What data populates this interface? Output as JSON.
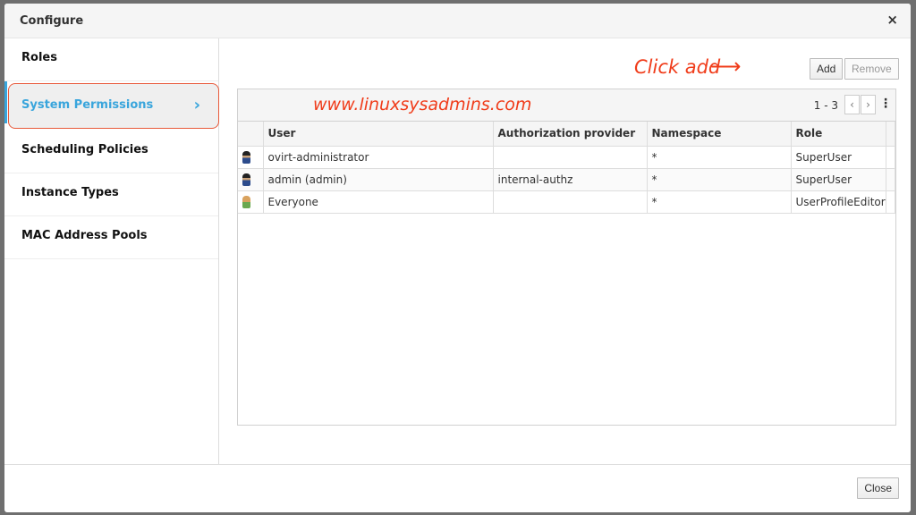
{
  "dialog": {
    "title": "Configure",
    "close_x": "×",
    "close_label": "Close"
  },
  "sidebar": {
    "items": [
      {
        "label": "Roles"
      },
      {
        "label": "System Permissions",
        "active": true
      },
      {
        "label": "Scheduling Policies"
      },
      {
        "label": "Instance Types"
      },
      {
        "label": "MAC Address Pools"
      }
    ],
    "chevron": "›"
  },
  "toolbar": {
    "add_label": "Add",
    "remove_label": "Remove"
  },
  "annotations": {
    "click_add": "Click add",
    "arrow": "⟶",
    "watermark": "www.linuxsysadmins.com",
    "color": "#f03c1a"
  },
  "pagination": {
    "range": "1 - 3",
    "prev": "‹",
    "next": "›",
    "kebab": "⋮"
  },
  "table": {
    "columns": [
      "User",
      "Authorization provider",
      "Namespace",
      "Role"
    ],
    "rows": [
      {
        "icon": "admin-user-icon",
        "user": "ovirt-administrator",
        "provider": "",
        "namespace": "*",
        "role": "SuperUser"
      },
      {
        "icon": "admin-user-icon",
        "user": "admin (admin)",
        "provider": "internal-authz",
        "namespace": "*",
        "role": "SuperUser"
      },
      {
        "icon": "group-user-icon",
        "user": "Everyone",
        "provider": "",
        "namespace": "*",
        "role": "UserProfileEditor"
      }
    ]
  },
  "colors": {
    "accent": "#39a5dc",
    "highlight": "#e8593a"
  }
}
